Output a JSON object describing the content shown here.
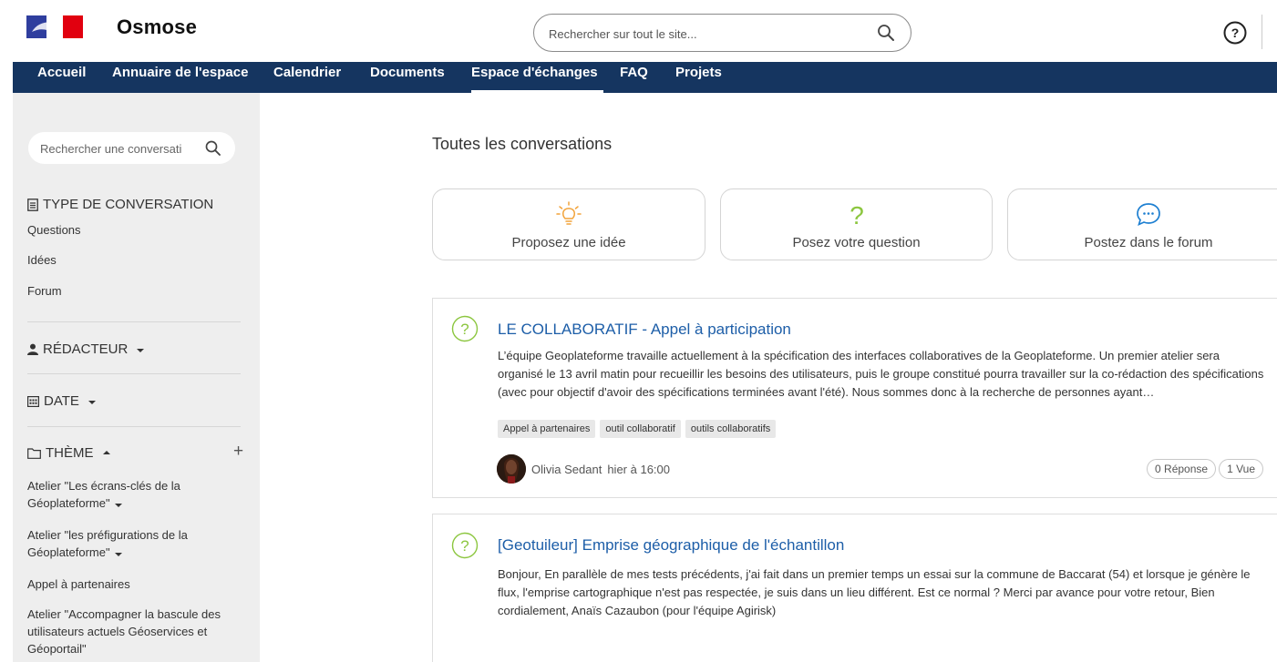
{
  "header": {
    "brand": "Osmose",
    "search_placeholder": "Rechercher sur tout le site...",
    "icons": [
      "republique-flag-logo",
      "search-icon",
      "help-icon"
    ]
  },
  "nav": {
    "items": [
      {
        "label": "Accueil",
        "active": false
      },
      {
        "label": "Annuaire de l'espace",
        "active": false
      },
      {
        "label": "Calendrier",
        "active": false
      },
      {
        "label": "Documents",
        "active": false
      },
      {
        "label": "Espace d'échanges",
        "active": true
      },
      {
        "label": "FAQ",
        "active": false
      },
      {
        "label": "Projets",
        "active": false
      }
    ]
  },
  "sidebar": {
    "search_placeholder": "Rechercher une conversati",
    "type_heading": "TYPE DE CONVERSATION",
    "types": [
      "Questions",
      "Idées",
      "Forum"
    ],
    "author_heading": "RÉDACTEUR",
    "date_heading": "DATE",
    "theme_heading": "THÈME",
    "themes": [
      "Atelier \"Les écrans-clés de la Géoplateforme\"",
      "Atelier \"les préfigurations de la Géoplateforme\"",
      "Appel à partenaires",
      "Atelier \"Accompagner la bascule des utilisateurs actuels Géoservices et Géoportail\""
    ]
  },
  "main": {
    "title": "Toutes les conversations",
    "actions": [
      {
        "label": "Proposez une idée",
        "icon": "lightbulb-icon",
        "color": "#f2a33a"
      },
      {
        "label": "Posez votre question",
        "icon": "question-icon",
        "color": "#8cc63f"
      },
      {
        "label": "Postez dans le forum",
        "icon": "chat-bubble-icon",
        "color": "#1d7fd1"
      }
    ],
    "conversations": [
      {
        "title": "LE COLLABORATIF - Appel à participation",
        "excerpt": "L’équipe Geoplateforme travaille actuellement à la spécification des interfaces collaboratives de la Geoplateforme. Un premier atelier sera organisé le 13 avril matin pour recueillir les besoins des utilisateurs, puis le groupe constitué pourra travailler sur la co-rédaction des spécifications (avec pour objectif d'avoir des spécifications terminées avant l'été). Nous sommes donc à la recherche de personnes ayant…",
        "tags": [
          "Appel à partenaires",
          "outil collaboratif",
          "outils collaboratifs"
        ],
        "author": "Olivia Sedant",
        "time": "hier à 16:00",
        "replies": "0 Réponse",
        "views": "1 Vue"
      },
      {
        "title": "[Geotuileur] Emprise géographique de l'échantillon",
        "excerpt": "Bonjour, En parallèle de mes tests précédents, j'ai fait dans un premier temps un essai sur la commune de Baccarat (54) et lorsque je génère le flux, l'emprise cartographique n'est pas respectée, je suis dans un lieu différent. Est ce normal ? Merci par avance pour votre retour, Bien cordialement, Anaïs Cazaubon (pour l'équipe Agirisk)"
      }
    ]
  },
  "colors": {
    "nav_bg": "#153560",
    "sidebar_bg": "#eeeeee",
    "link": "#1d5ea8",
    "question_green": "#8cc63f"
  }
}
